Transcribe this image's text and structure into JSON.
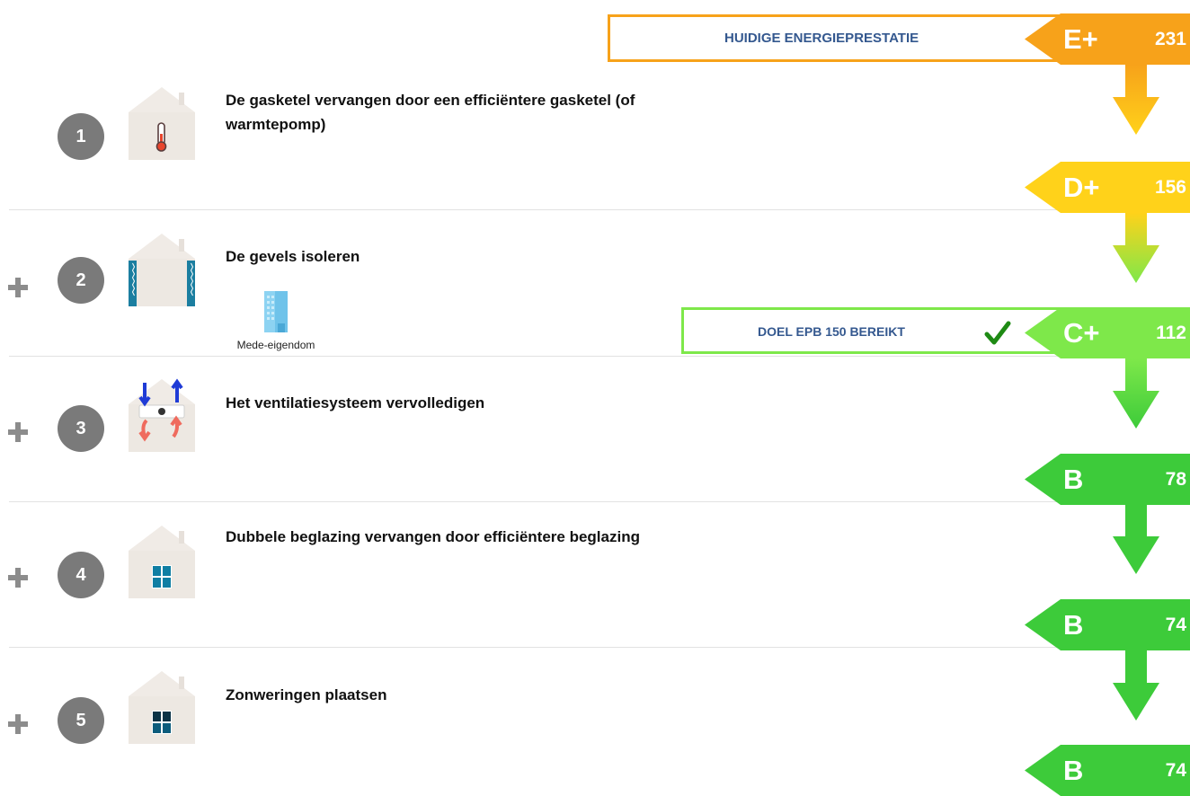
{
  "current_label": "HUIDIGE ENERGIEPRESTATIE",
  "target_label": "DOEL EPB 150 BEREIKT",
  "steps": [
    {
      "number": "1",
      "title": "De gasketel vervangen door een efficiëntere gasketel (of warmtepomp)",
      "icon": "thermometer-icon"
    },
    {
      "number": "2",
      "title": "De gevels isoleren",
      "icon": "facade-insulation-icon",
      "co_ownership_label": "Mede-eigendom"
    },
    {
      "number": "3",
      "title": "Het ventilatiesysteem vervolledigen",
      "icon": "ventilation-icon"
    },
    {
      "number": "4",
      "title": "Dubbele beglazing vervangen door efficiëntere beglazing",
      "icon": "window-glazing-icon"
    },
    {
      "number": "5",
      "title": "Zonweringen plaatsen",
      "icon": "sunshade-window-icon"
    }
  ],
  "badges": [
    {
      "class": "E+",
      "value": "231",
      "color": "#f7a21a"
    },
    {
      "class": "D+",
      "value": "156",
      "color": "#ffd21a"
    },
    {
      "class": "C+",
      "value": "112",
      "color": "#7ee84a"
    },
    {
      "class": "B",
      "value": "78",
      "color": "#3dcb3a"
    },
    {
      "class": "B",
      "value": "74",
      "color": "#3dcb3a"
    },
    {
      "class": "B",
      "value": "74",
      "color": "#3dcb3a"
    }
  ],
  "colors": {
    "current_border": "#f7a21a",
    "target_border": "#7ee84a",
    "label_text": "#34588f",
    "check": "#1e8a14",
    "circle": "#7a7a7a"
  }
}
